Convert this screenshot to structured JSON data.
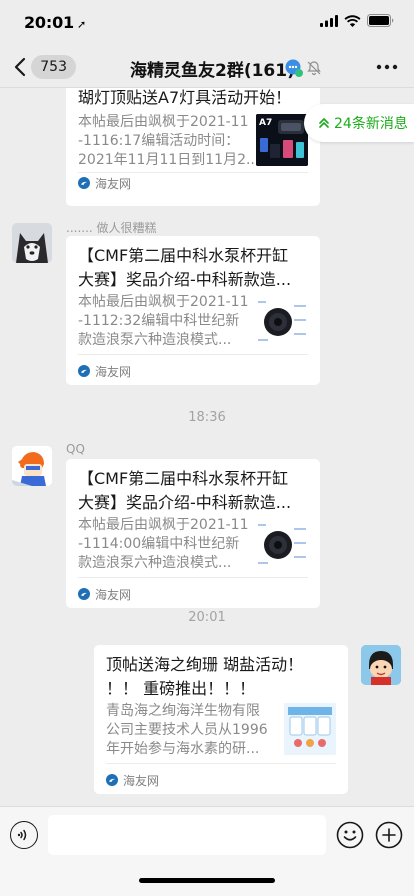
{
  "status_bar": {
    "time": "20:01",
    "location_glyph": "➚"
  },
  "nav": {
    "unread_count": "753",
    "title": "海精灵鱼友2群(161)"
  },
  "new_messages": {
    "label": "24条新消息"
  },
  "messages": [
    {
      "card": {
        "title_lines": [
          "瑚灯顶贴送A7灯具活动开始！"
        ],
        "desc_lines": [
          "本帖最后由飒枫于2021-11",
          "-1116:17编辑活动时间：",
          "2021年11月11日到11月2..."
        ],
        "source": "海友网"
      }
    },
    {
      "sender": "....... 做人很糟糕",
      "card": {
        "title_lines": [
          "【CMF第二届中科水泵杯开缸",
          "大赛】奖品介绍-中科新款造..."
        ],
        "desc_lines": [
          "本帖最后由飒枫于2021-11",
          "-1112:32编辑中科世纪新",
          "款造浪泵六种造浪模式..."
        ],
        "source": "海友网"
      }
    },
    {
      "time": "18:36"
    },
    {
      "sender": "QQ",
      "card": {
        "title_lines": [
          "【CMF第二届中科水泵杯开缸",
          "大赛】奖品介绍-中科新款造..."
        ],
        "desc_lines": [
          "本帖最后由飒枫于2021-11",
          "-1114:00编辑中科世纪新",
          "款造浪泵六种造浪模式..."
        ],
        "source": "海友网"
      }
    },
    {
      "time": "20:01"
    },
    {
      "card": {
        "title_lines": [
          "顶帖送海之绚珊 瑚盐活动！",
          "！！ 重磅推出！！！"
        ],
        "desc_lines": [
          "青岛海之绚海洋生物有限",
          "公司主要技术人员从1996",
          "年开始参与海水素的研..."
        ],
        "source": "海友网"
      }
    }
  ],
  "colors": {
    "accent": "#1aad19",
    "background": "#ededed",
    "bubble": "#ffffff",
    "source_icon": "#1f6fb6"
  }
}
